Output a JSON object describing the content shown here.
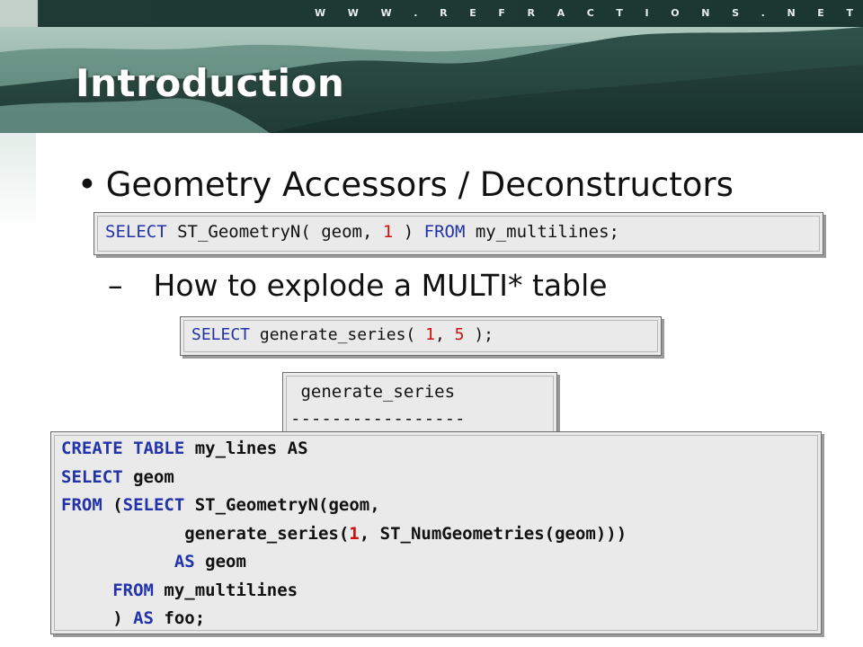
{
  "header": {
    "site_url": "W W W . R E F R A C T I O N S . N E T",
    "title": "Introduction"
  },
  "bullet": {
    "symbol": "•",
    "text": "Geometry Accessors / Deconstructors"
  },
  "sub_bullet": {
    "symbol": "–",
    "text": "How to explode a MULTI* table"
  },
  "code_boxes": {
    "box1": [
      "SELECT",
      " ST_GeometryN( geom, ",
      "1",
      " ) ",
      "FROM",
      " my_multilines;"
    ],
    "box2": [
      "SELECT",
      " generate_series( ",
      "1",
      ", ",
      "5",
      " );"
    ],
    "box3": [
      " generate_series",
      "-----------------"
    ],
    "box4": {
      "line1": [
        "CREATE TABLE",
        " my_lines ",
        "AS"
      ],
      "line2": [
        "SELECT",
        " geom"
      ],
      "line3": [
        "FROM",
        " (",
        "SELECT",
        " ST_GeometryN(geom,"
      ],
      "line4": [
        "            generate_series(",
        "1",
        ", ST_NumGeometries(geom)))"
      ],
      "line5": [
        "           ",
        "AS",
        " geom"
      ],
      "line6": [
        "     ",
        "FROM",
        " my_multilines"
      ],
      "line7": [
        "     ) ",
        "AS",
        " foo;"
      ]
    }
  },
  "colors": {
    "keyword": "#2233aa",
    "number": "#cc1111",
    "code_background": "#eaeaea",
    "banner_dark": "#1c3630"
  }
}
